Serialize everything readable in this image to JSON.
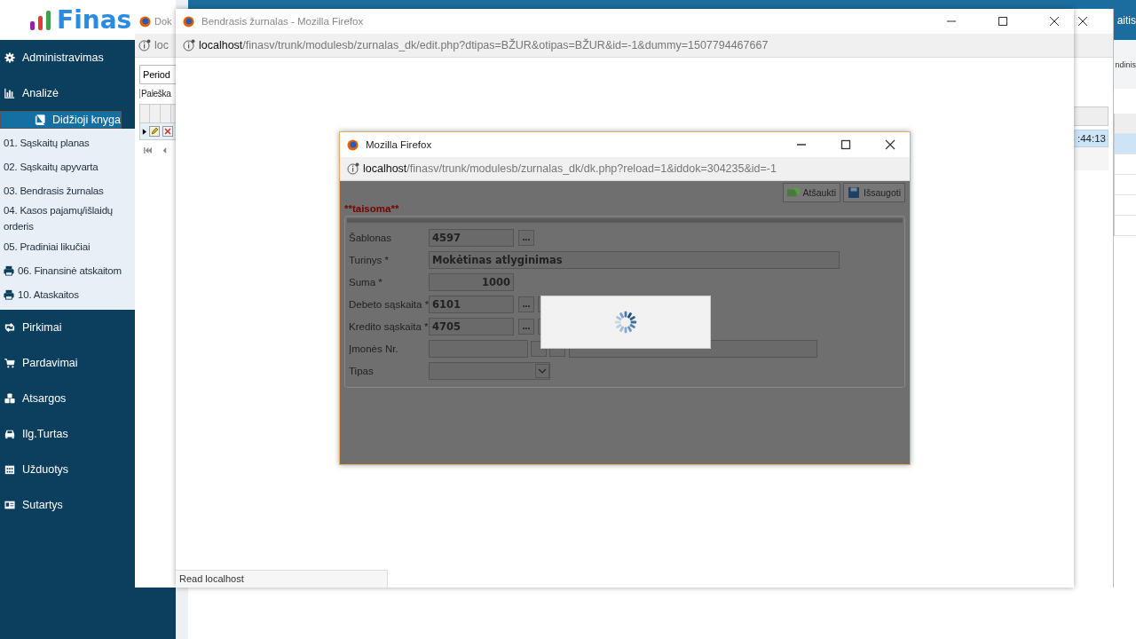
{
  "app": {
    "logo": "Finas",
    "topbar_text": "aitis",
    "toolbar_text": "ndinis"
  },
  "sidebar": {
    "items": [
      {
        "label": "Administravimas",
        "selected": false
      },
      {
        "label": "Analizė",
        "selected": false
      },
      {
        "label": "Didžioji knyga",
        "selected": true,
        "expanded": true,
        "children": [
          {
            "label": "01. Sąskaitų planas",
            "kind": "page",
            "selected": false
          },
          {
            "label": "02. Sąskaitų apyvarta",
            "kind": "page",
            "selected": false
          },
          {
            "label": "03. Bendrasis žurnalas",
            "kind": "page",
            "selected": false
          },
          {
            "label": "04. Kasos pajamų/išlaidų orderis",
            "kind": "page",
            "selected": false
          },
          {
            "label": "05. Pradiniai likučiai",
            "kind": "page",
            "selected": false
          },
          {
            "label": "06. Finansinė atskaitom",
            "kind": "report",
            "selected": false
          },
          {
            "label": "10. Ataskaitos",
            "kind": "report",
            "selected": false
          }
        ]
      },
      {
        "label": "Pirkimai",
        "selected": false
      },
      {
        "label": "Pardavimai",
        "selected": false
      },
      {
        "label": "Atsargos",
        "selected": false
      },
      {
        "label": "Ilg.Turtas",
        "selected": false
      },
      {
        "label": "Užduotys",
        "selected": false
      },
      {
        "label": "Sutartys",
        "selected": false
      }
    ]
  },
  "background_window": {
    "title": "Dok",
    "url": "loc",
    "period_button": "Period",
    "search_label": "Paieška",
    "time_cell": ":44:13"
  },
  "browser_window": {
    "title": "Bendrasis žurnalas - Mozilla Firefox",
    "url_host": "localhost",
    "url_path": "/finasv/trunk/modulesb/zurnalas_dk/edit.php?dtipas=BŽUR&otipas=BŽUR&id=-1&dummy=1507794467667",
    "status": "Read localhost"
  },
  "dialog": {
    "title": "Mozilla Firefox",
    "url_host": "localhost",
    "url_path": "/finasv/trunk/modulesb/zurnalas_dk/dk.php?reload=1&iddok=304235&id=-1",
    "buttons": [
      {
        "label": "Atšaukti",
        "kind": "cancel"
      },
      {
        "label": "Išsaugoti",
        "kind": "save"
      }
    ],
    "mode": "**taisoma**",
    "loading": true,
    "rows": [
      {
        "label": "Šablonas",
        "kind": "lookup",
        "value": "4597",
        "button": "..."
      },
      {
        "label": "Turinys *",
        "kind": "text",
        "value": "Mokėtinas atlyginimas"
      },
      {
        "label": "Suma *",
        "kind": "amount",
        "value": "1000"
      },
      {
        "label": "Debeto sąskaita *",
        "kind": "account",
        "value": "6101",
        "button": "..."
      },
      {
        "label": "Kredito sąskaita *",
        "kind": "account",
        "value": "4705",
        "button": "..."
      },
      {
        "label": "Įmonės Nr.",
        "kind": "company"
      },
      {
        "label": "Tipas",
        "kind": "select"
      }
    ]
  }
}
